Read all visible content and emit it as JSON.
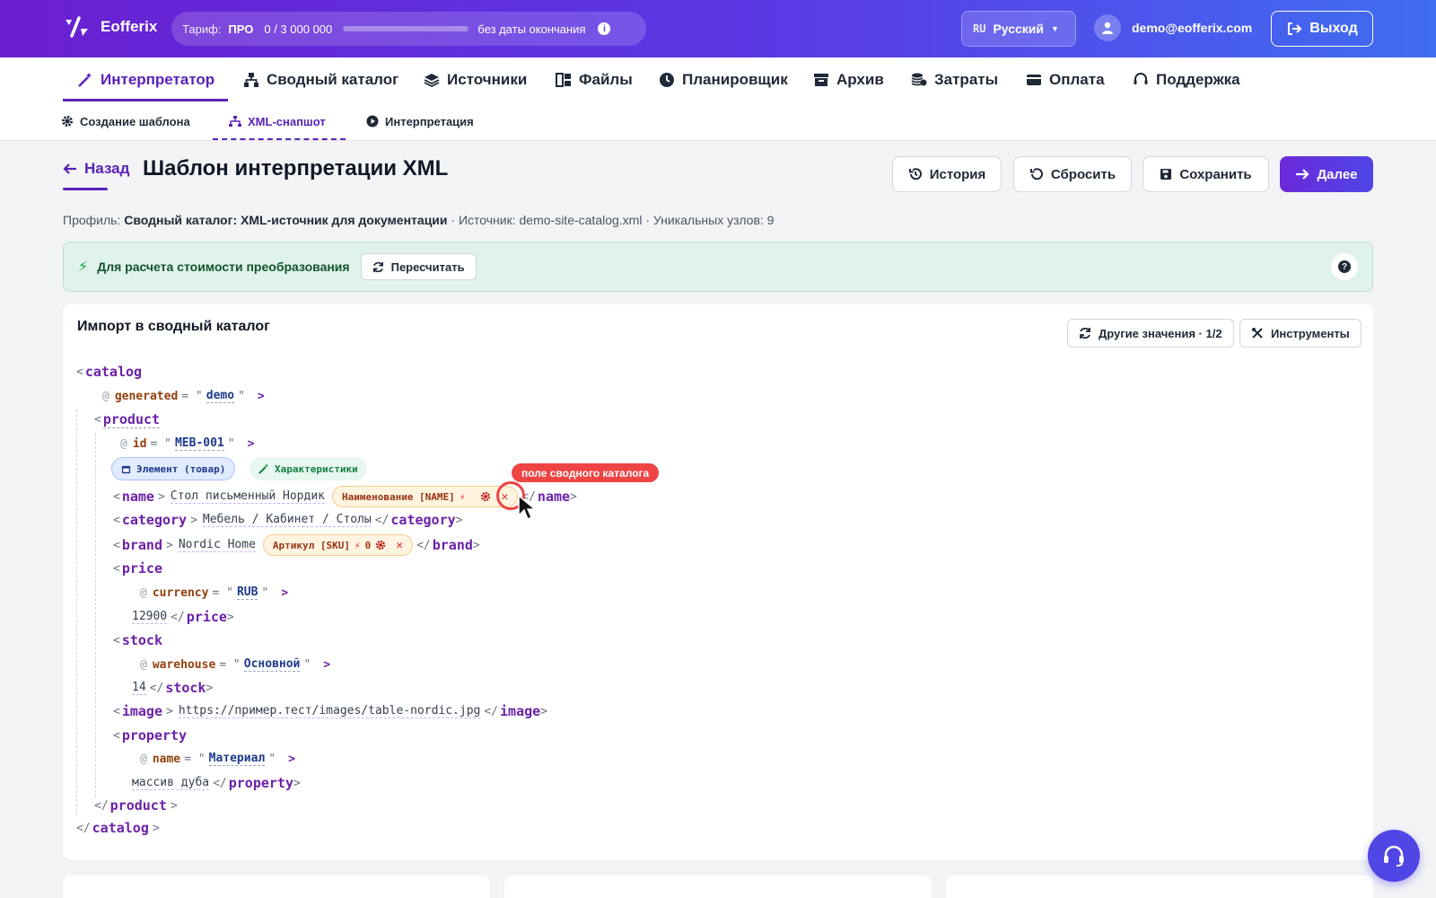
{
  "app": {
    "name": "Eofferix"
  },
  "plan": {
    "label": "Тариф:",
    "tier": "ПРО",
    "quota": "0 / 3 000 000",
    "usage_fraction": 0.0,
    "expiry": "без даты окончания"
  },
  "lang": {
    "code": "RU",
    "label": "Русский"
  },
  "user": {
    "email": "demo@eofferix.com"
  },
  "logout_label": "Выход",
  "nav": [
    {
      "label": "Интерпретатор",
      "icon": "wand-icon",
      "active": true
    },
    {
      "label": "Сводный каталог",
      "icon": "hierarchy-icon"
    },
    {
      "label": "Источники",
      "icon": "layers-icon"
    },
    {
      "label": "Файлы",
      "icon": "files-icon"
    },
    {
      "label": "Планировщик",
      "icon": "clock-icon"
    },
    {
      "label": "Архив",
      "icon": "archive-icon"
    },
    {
      "label": "Затраты",
      "icon": "coins-icon"
    },
    {
      "label": "Оплата",
      "icon": "card-icon"
    },
    {
      "label": "Поддержка",
      "icon": "headset-icon"
    }
  ],
  "subnav": [
    {
      "label": "Создание шаблона",
      "icon": "gear-icon"
    },
    {
      "label": "XML-снапшот",
      "icon": "sitemap-icon",
      "active": true
    },
    {
      "label": "Интерпретация",
      "icon": "play-icon"
    }
  ],
  "page": {
    "back": "Назад",
    "title": "Шаблон интерпретации XML",
    "actions": {
      "history": "История",
      "reset": "Сбросить",
      "save": "Сохранить",
      "next": "Далее"
    },
    "meta": {
      "profile_label": "Профиль:",
      "profile": "Сводный каталог: XML-источник для документации",
      "source_label": "· Источник:",
      "source": "demo-site-catalog.xml",
      "nodes_label": "· Уникальных узлов:",
      "nodes": "9"
    }
  },
  "banner": {
    "text": "Для расчета стоимости преобразования",
    "recalc": "Пересчитать",
    "help": "?"
  },
  "panel": {
    "title": "Импорт в сводный каталог",
    "other_values": "Другие значения · 1/2",
    "tools": "Инструменты",
    "badge_element": "Элемент (товар)",
    "badge_props": "Характеристики",
    "tooltip": "поле сводного каталога",
    "xml": {
      "catalog": "catalog",
      "generated_attr": "generated",
      "generated_val": "demo",
      "product": "product",
      "id_attr": "id",
      "id_val": "MEB-001",
      "name_tag": "name",
      "name_val": "Стол письменный Нордик",
      "name_chip": "Наименование [NAME]",
      "category_tag": "category",
      "category_val": "Мебель / Кабинет / Столы",
      "brand_tag": "brand",
      "brand_val": "Nordic Home",
      "brand_chip": "Артикул [SKU]",
      "brand_chip_count": "0",
      "price_tag": "price",
      "currency_attr": "currency",
      "currency_val": "RUB",
      "price_val": "12900",
      "stock_tag": "stock",
      "warehouse_attr": "warehouse",
      "warehouse_val": "Основной",
      "stock_val": "14",
      "image_tag": "image",
      "image_val": "https://пример.тест/images/table-nordic.jpg",
      "property_tag": "property",
      "pname_attr": "name",
      "pname_val": "Материал",
      "property_val": "массив дуба"
    }
  },
  "colors": {
    "accent": "#5b21b6",
    "primary_start": "#6d28d9",
    "primary_end": "#4f46e5",
    "banner_bg": "#dff3ea",
    "tooltip": "#ef4444"
  }
}
